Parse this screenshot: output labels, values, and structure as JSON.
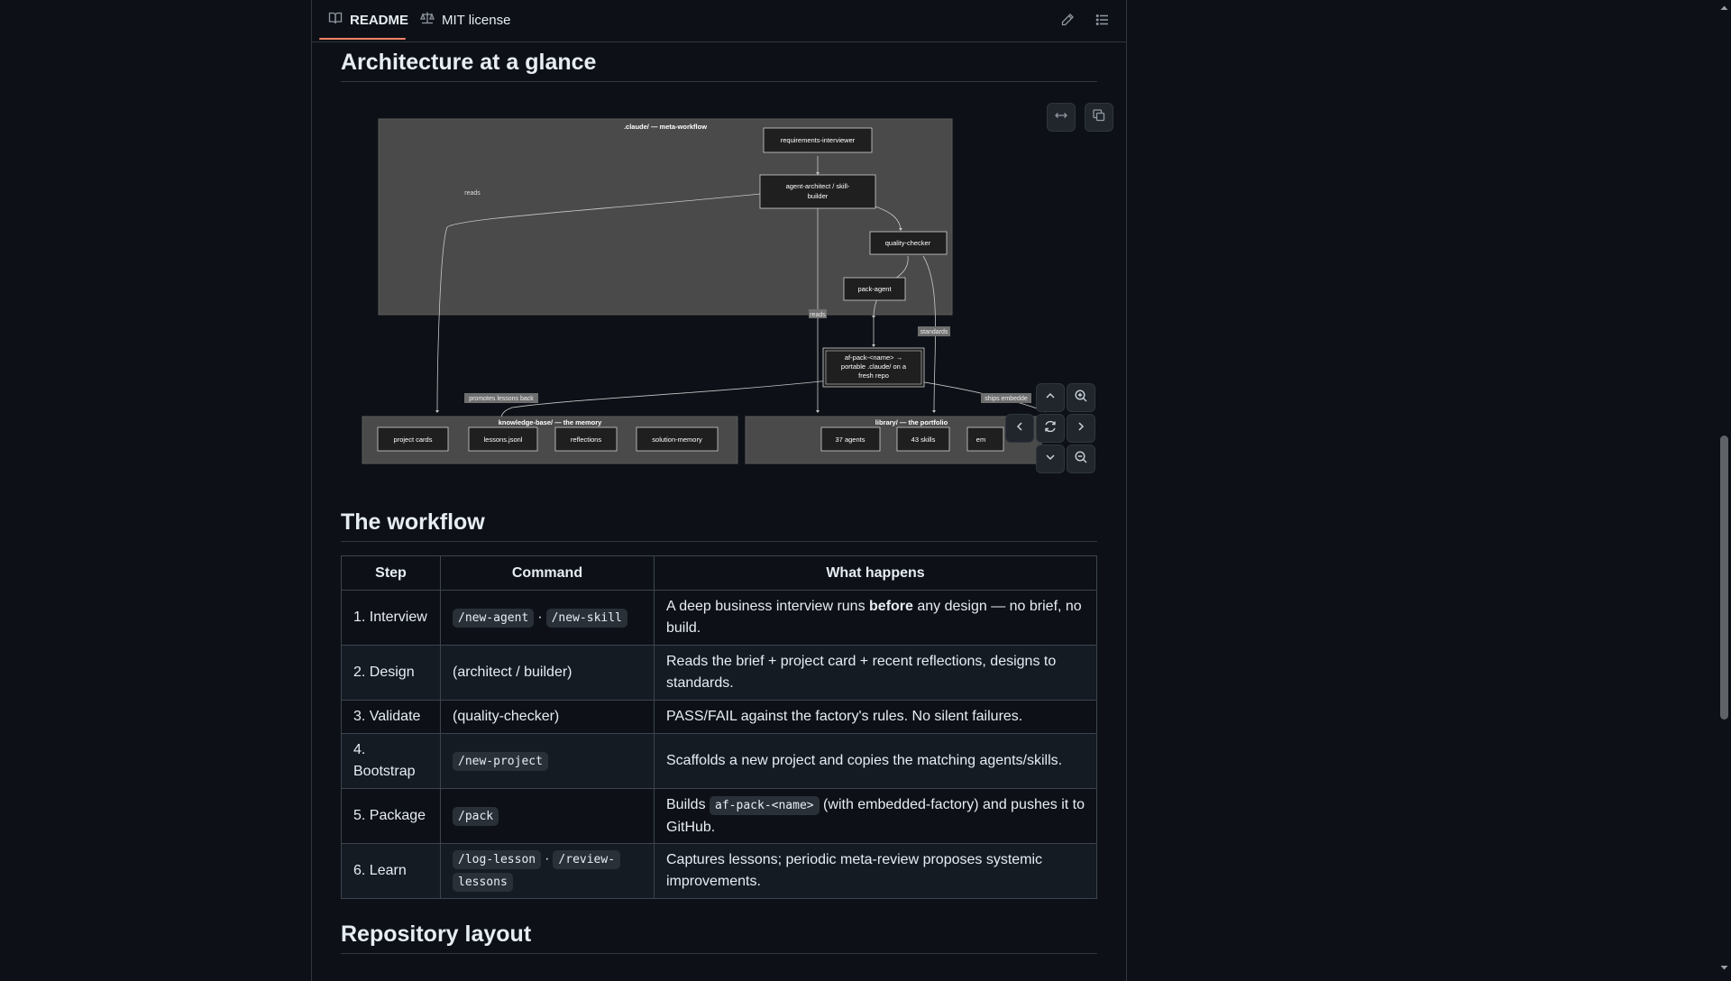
{
  "tabs": {
    "readme": "README",
    "license": "MIT license"
  },
  "architecture": {
    "title": "Architecture at a glance",
    "diagram": {
      "meta_group_label": ".claude/ — meta-workflow",
      "memory_group_label": "knowledge-base/ — the memory",
      "library_group_label": "library/ — the portfolio",
      "nodes": {
        "requirements": "requirements-interviewer",
        "architect_line1": "agent-architect / skill-",
        "architect_line2": "builder",
        "quality": "quality-checker",
        "pack": "pack-agent",
        "afpack_line1": "af-pack-<name> →",
        "afpack_line2": "portable .claude/ on a",
        "afpack_line3": "fresh repo",
        "project_cards": "project cards",
        "lessons": "lessons.jsonl",
        "reflections": "reflections",
        "solution_memory": "solution-memory",
        "agents": "37 agents",
        "skills": "43 skills",
        "em": "em"
      },
      "edge_labels": {
        "reads1": "reads",
        "reads2": "reads",
        "standards": "standards",
        "promotes": "promotes lessons back",
        "ships": "ships embedde"
      }
    }
  },
  "workflow": {
    "title": "The workflow",
    "headers": [
      "Step",
      "Command",
      "What happens"
    ],
    "rows": [
      {
        "step": "1. Interview",
        "cmd1": "/new-agent",
        "sep": "·",
        "cmd2": "/new-skill",
        "what_before": "A deep business interview runs ",
        "what_bold": "before",
        "what_after": " any design — no brief, no build."
      },
      {
        "step": "2. Design",
        "cmd_text": "(architect / builder)",
        "what": "Reads the brief + project card + recent reflections, designs to standards."
      },
      {
        "step": "3. Validate",
        "cmd_text": "(quality-checker)",
        "what": "PASS/FAIL against the factory's rules. No silent failures."
      },
      {
        "step_line1": "4.",
        "step_line2": "Bootstrap",
        "cmd1": "/new-project",
        "what": "Scaffolds a new project and copies the matching agents/skills."
      },
      {
        "step": "5. Package",
        "cmd1": "/pack",
        "what_before": "Builds ",
        "what_code": "af-pack-<name>",
        "what_after": " (with embedded-factory) and pushes it to GitHub."
      },
      {
        "step": "6. Learn",
        "cmd1": "/log-lesson",
        "sep": "·",
        "cmd2a": "/review-",
        "cmd2b": "lessons",
        "what": "Captures lessons; periodic meta-review proposes systemic improvements."
      }
    ]
  },
  "repository": {
    "title": "Repository layout"
  },
  "colors": {
    "background": "#0d1117",
    "border": "#30363d",
    "tab_underline": "#f78166",
    "diagram_cluster": "#4a4a4a",
    "diagram_node": "#1f1f1f"
  }
}
